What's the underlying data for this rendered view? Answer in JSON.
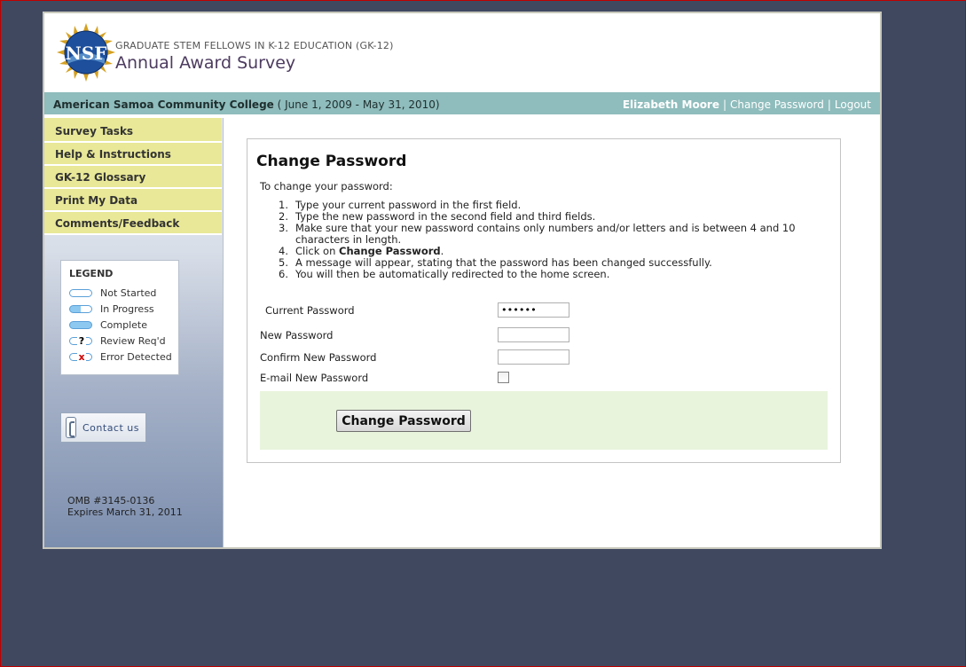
{
  "header": {
    "program_title": "GRADUATE STEM FELLOWS IN K-12 EDUCATION (GK-12)",
    "survey_title": "Annual Award Survey",
    "logo_text": "NSF"
  },
  "infobar": {
    "college": "American Samoa Community College",
    "period": "( June 1, 2009 - May 31, 2010)",
    "user": "Elizabeth Moore",
    "change_password": "Change Password",
    "logout": "Logout",
    "separator": "|"
  },
  "sidebar": {
    "items": [
      {
        "label": "Survey Tasks"
      },
      {
        "label": "Help & Instructions"
      },
      {
        "label": "GK-12 Glossary"
      },
      {
        "label": "Print My Data"
      },
      {
        "label": "Comments/Feedback"
      }
    ],
    "legend": {
      "title": "LEGEND",
      "entries": [
        {
          "label": "Not Started",
          "icon": "not-started-icon"
        },
        {
          "label": "In Progress",
          "icon": "in-progress-icon"
        },
        {
          "label": "Complete",
          "icon": "complete-icon"
        },
        {
          "label": "Review Req'd",
          "icon": "review-required-icon",
          "mark": "?"
        },
        {
          "label": "Error Detected",
          "icon": "error-detected-icon",
          "mark": "x"
        }
      ]
    },
    "contact_label": "Contact us",
    "omb_number": "OMB #3145-0136",
    "omb_expires": "Expires March 31, 2011"
  },
  "main": {
    "title": "Change Password",
    "intro": "To change your password:",
    "steps": [
      {
        "num": "1.",
        "text": "Type your current password in the first field."
      },
      {
        "num": "2.",
        "text": "Type the new password in the second field and third fields."
      },
      {
        "num": "3.",
        "text": "Make sure that your new password contains only numbers and/or letters and is between 4 and 10 characters in length."
      },
      {
        "num": "4.",
        "pre": "Click on ",
        "bold": "Change Password",
        "post": "."
      },
      {
        "num": "5.",
        "text": "A message will appear, stating that the password has been changed successfully."
      },
      {
        "num": "6.",
        "text": "You will then be automatically redirected to the home screen."
      }
    ],
    "fields": {
      "current_password_label": "Current Password",
      "current_password_value": "••••••",
      "new_password_label": "New Password",
      "new_password_value": "",
      "confirm_password_label": "Confirm New Password",
      "confirm_password_value": "",
      "email_password_label": "E-mail New Password",
      "email_password_checked": false
    },
    "submit_label": "Change Password"
  },
  "colors": {
    "background": "#404860",
    "nav_item": "#e8e898",
    "infobar": "#8fbcbc",
    "submit_area": "#e8f4dc"
  }
}
